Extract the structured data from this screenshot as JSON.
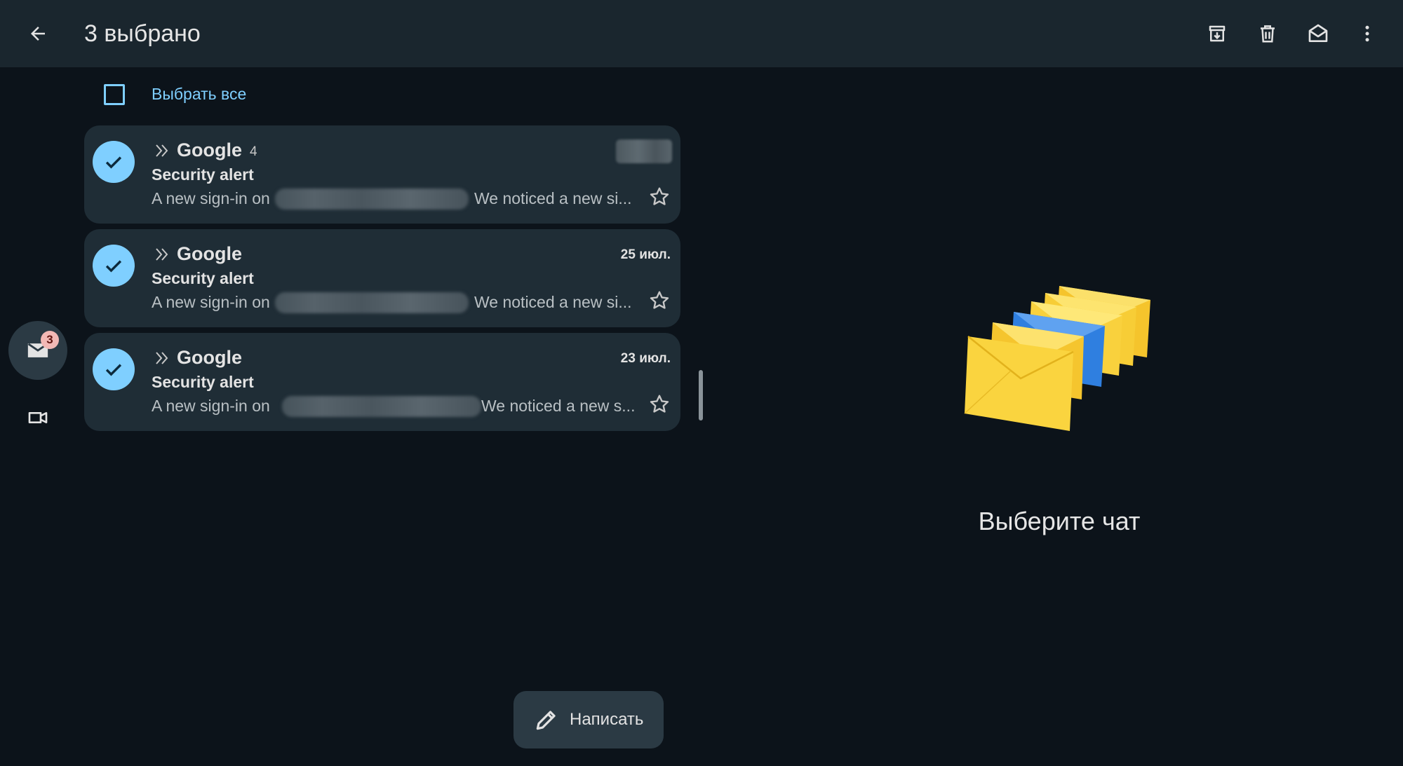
{
  "header": {
    "title": "3 выбрано",
    "actions": [
      "archive-icon",
      "trash-icon",
      "mark-unread-icon",
      "more-vert-icon"
    ]
  },
  "select_all": {
    "label": "Выбрать все",
    "checked": false
  },
  "emails": [
    {
      "sender": "Google",
      "count": "4",
      "date": "",
      "subject": "Security alert",
      "snippet_prefix": "A new sign-in on",
      "snippet_suffix": "We noticed a new si...",
      "selected": true,
      "starred": false
    },
    {
      "sender": "Google",
      "count": "",
      "date": "25 июл.",
      "subject": "Security alert",
      "snippet_prefix": "A new sign-in on",
      "snippet_suffix": "We noticed a new si...",
      "selected": true,
      "starred": false
    },
    {
      "sender": "Google",
      "count": "",
      "date": "23 июл.",
      "subject": "Security alert",
      "snippet_prefix": "A new sign-in on",
      "snippet_suffix": "We noticed a new s...",
      "selected": true,
      "starred": false
    }
  ],
  "nav": {
    "mail_badge": "3"
  },
  "compose": {
    "label": "Написать"
  },
  "empty_state": {
    "text": "Выберите чат"
  },
  "colors": {
    "accent": "#7fcfff",
    "topbar": "#1a262e",
    "card": "#1f2d36",
    "background": "#0c131a",
    "envelope_yellow": "#f7d33c",
    "envelope_blue": "#2f7fe0"
  }
}
